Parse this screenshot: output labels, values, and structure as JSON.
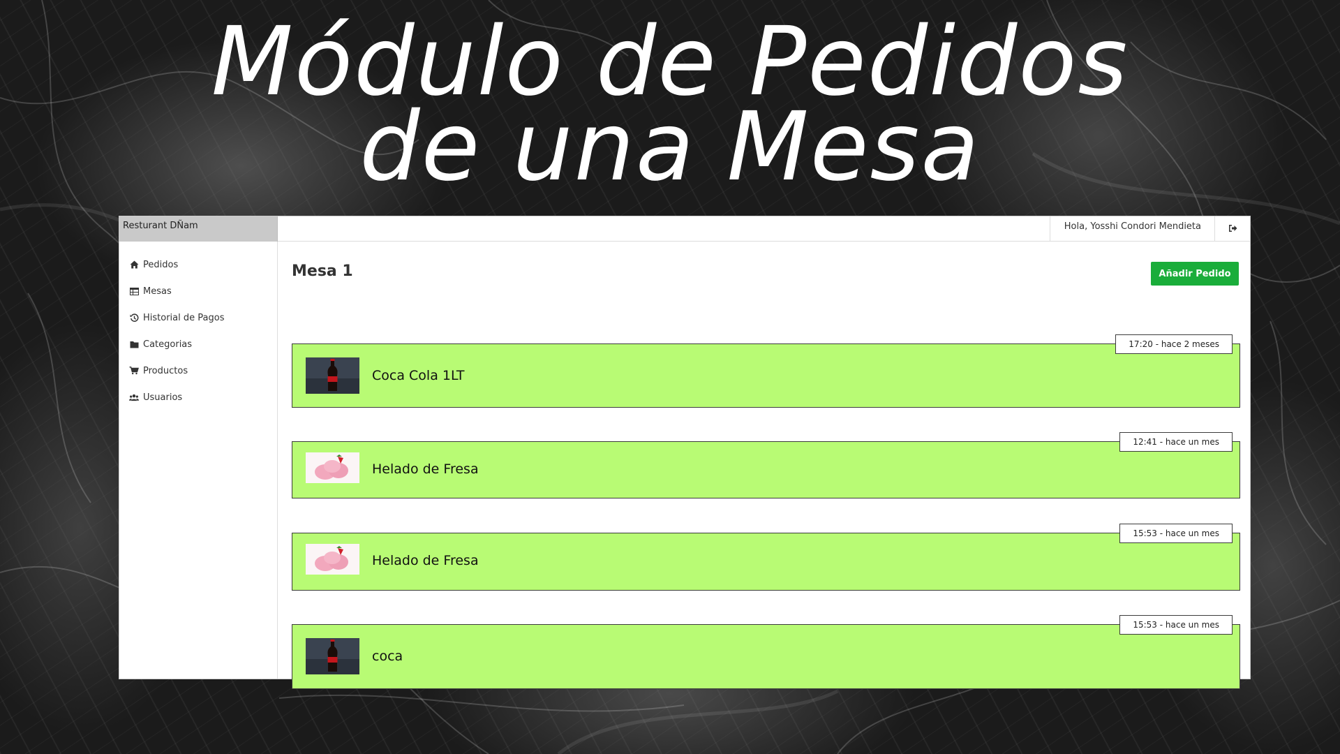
{
  "headline": {
    "line1": "Módulo de Pedidos",
    "line2": "de una Mesa"
  },
  "app": {
    "brand": "Resturant DÑam",
    "greeting": "Hola, Yosshi Condori Mendieta",
    "logout_icon": "sign-out-icon",
    "accent_color": "#1aad3a",
    "order_color": "#b8fb74"
  },
  "sidebar": {
    "items": [
      {
        "label": "Pedidos",
        "icon": "home-icon"
      },
      {
        "label": "Mesas",
        "icon": "table-icon"
      },
      {
        "label": "Historial de Pagos",
        "icon": "history-icon"
      },
      {
        "label": "Categorias",
        "icon": "folder-icon"
      },
      {
        "label": "Productos",
        "icon": "cart-icon"
      },
      {
        "label": "Usuarios",
        "icon": "users-icon"
      }
    ]
  },
  "main": {
    "title": "Mesa 1",
    "add_button": "Añadir Pedido",
    "orders": [
      {
        "name": "Coca Cola 1LT",
        "time": "17:20 - hace 2 meses",
        "image": "cola-bottle"
      },
      {
        "name": "Helado de Fresa",
        "time": "12:41 - hace un mes",
        "image": "strawberry-ice-cream"
      },
      {
        "name": "Helado de Fresa",
        "time": "15:53 - hace un mes",
        "image": "strawberry-ice-cream"
      },
      {
        "name": "coca",
        "time": "15:53 - hace un mes",
        "image": "cola-bottle"
      }
    ]
  }
}
